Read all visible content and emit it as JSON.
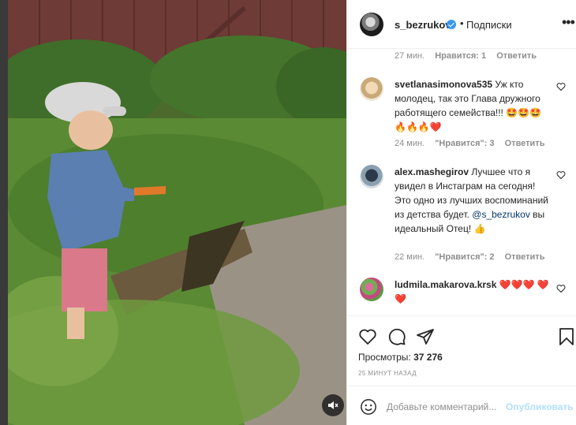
{
  "post": {
    "author": "s_bezrukov",
    "follow_label": "Подписки",
    "dot": "•",
    "more_label": "•••"
  },
  "top_meta": {
    "time": "27 мин.",
    "likes": "Нравится: 1",
    "reply": "Ответить"
  },
  "comments": [
    {
      "user": "svetlanasimonova535",
      "text": "Уж кто молодец, так это Глава дружного работящего семейства!!! 🤩🤩🤩🔥🔥🔥❤️",
      "time": "24 мин.",
      "likes": "\"Нравится\": 3",
      "reply": "Ответить"
    },
    {
      "user": "alex.mashegirov",
      "text_before": "Лучшее что я увидел в Инстаграм на сегодня! Это одно из лучших воспоминаний из детства будет.",
      "mention": "@s_bezrukov",
      "text_after": "вы идеальный Отец! 👍",
      "time": "22 мин.",
      "likes": "\"Нравится\": 2",
      "reply": "Ответить"
    },
    {
      "user": "ludmila.makarova.krsk",
      "text": "❤️❤️❤️ ❤️❤️"
    }
  ],
  "stats": {
    "views_label": "Просмотры:",
    "views_count": "37 276",
    "time_ago": "25 МИНУТ НАЗАД"
  },
  "add_comment": {
    "placeholder": "Добавьте комментарий...",
    "publish": "Опубликовать"
  },
  "icons": {
    "like": "heart-icon",
    "comment": "comment-icon",
    "share": "paper-plane-icon",
    "save": "bookmark-icon",
    "mute": "speaker-muted-icon",
    "emoji": "smiley-icon",
    "verified": "verified-badge-icon"
  },
  "colors": {
    "accent": "#3897f0",
    "publish_disabled": "#b2dffc",
    "muted_text": "#8e8e8e"
  }
}
